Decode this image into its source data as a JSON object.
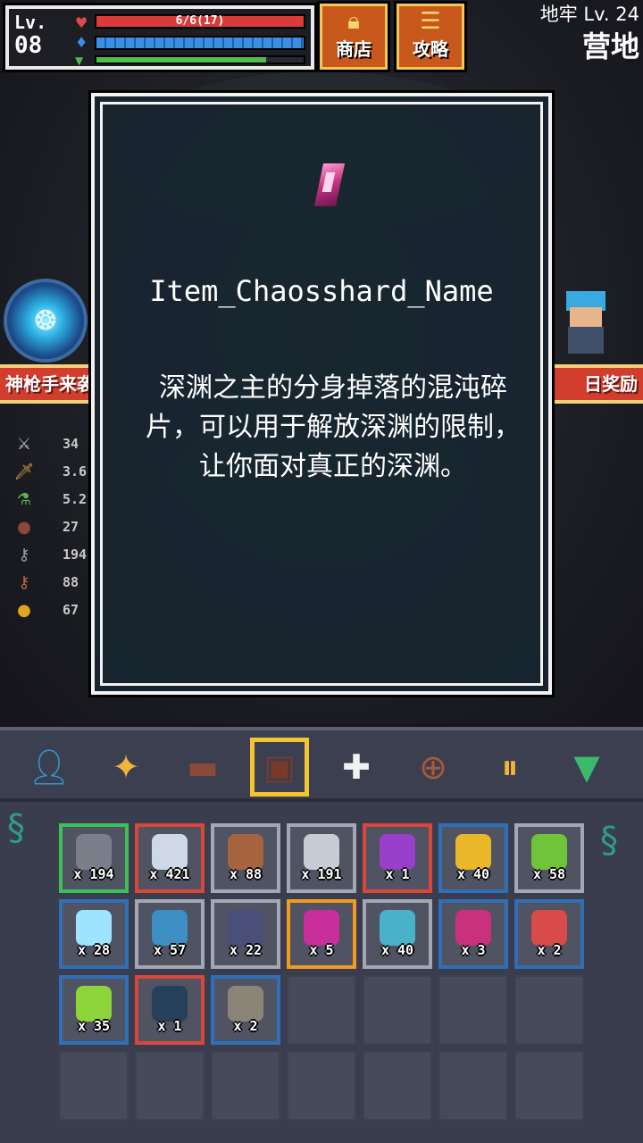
{
  "hud": {
    "level_label": "Lv.",
    "level_value": "08",
    "hp_text": "6/6(17)",
    "hp_fraction": 1.0,
    "mp_fraction": 1.0,
    "xp_fraction": 0.82,
    "colors": {
      "hp": "#d93b3b",
      "mp": "#3b8fe2",
      "xp": "#4ebc4e"
    }
  },
  "top_buttons": {
    "shop_label": "商店",
    "shop_icon": "shopping-bag-icon",
    "guide_label": "攻略",
    "guide_icon": "scroll-icon"
  },
  "location": {
    "dungeon_level": "地牢 Lv. 24",
    "area": "营地"
  },
  "side": {
    "left_banner": "神枪手来袭",
    "right_banner": "日奖励"
  },
  "stats": [
    {
      "icon": "crossed-swords-icon",
      "value": "34"
    },
    {
      "icon": "sword-icon",
      "value": "3.6"
    },
    {
      "icon": "potion-icon",
      "value": "5.2"
    },
    {
      "icon": "shield-icon",
      "value": "27"
    },
    {
      "icon": "gray-key-icon",
      "value": "194"
    },
    {
      "icon": "bronze-key-icon",
      "value": "88"
    },
    {
      "icon": "gold-coin-icon",
      "value": "67"
    }
  ],
  "tooltip": {
    "item_icon": "chaos-shard-icon",
    "item_name": "Item_Chaosshard_Name",
    "description": "深渊之主的分身掉落的混沌碎片，可以用于解放深渊的限制，让你面对真正的深渊。"
  },
  "toolbar": {
    "tabs": [
      {
        "icon": "character-silhouette-icon",
        "selected": false
      },
      {
        "icon": "sparkle-star-icon",
        "selected": false
      },
      {
        "icon": "book-icon",
        "selected": false
      },
      {
        "icon": "backpack-icon",
        "selected": true
      },
      {
        "icon": "white-cross-icon",
        "selected": false
      },
      {
        "icon": "magnifier-icon",
        "selected": false
      },
      {
        "icon": "pause-icon",
        "selected": false
      },
      {
        "icon": "collapse-arrow-icon",
        "selected": false
      }
    ]
  },
  "inventory": {
    "items": [
      {
        "icon": "gray-key-icon",
        "qty": "x 194",
        "rarity": "green"
      },
      {
        "icon": "torn-scroll-icon",
        "qty": "x 421",
        "rarity": "red"
      },
      {
        "icon": "bronze-key-icon",
        "qty": "x 88",
        "rarity": "gray"
      },
      {
        "icon": "silver-ore-icon",
        "qty": "x 191",
        "rarity": "gray"
      },
      {
        "icon": "purple-mushroom-icon",
        "qty": "x 1",
        "rarity": "red"
      },
      {
        "icon": "gold-key-icon",
        "qty": "x 40",
        "rarity": "blue"
      },
      {
        "icon": "green-tree-icon",
        "qty": "x 58",
        "rarity": "gray"
      },
      {
        "icon": "ice-crystal-icon",
        "qty": "x 28",
        "rarity": "blue"
      },
      {
        "icon": "blue-ore-icon",
        "qty": "x 57",
        "rarity": "gray"
      },
      {
        "icon": "dark-ore-icon",
        "qty": "x 22",
        "rarity": "gray"
      },
      {
        "icon": "diamond-gem-icon",
        "qty": "x 5",
        "rarity": "orange"
      },
      {
        "icon": "aqua-ore-icon",
        "qty": "x 40",
        "rarity": "gray"
      },
      {
        "icon": "chaos-shard-icon",
        "qty": "x 3",
        "rarity": "blue"
      },
      {
        "icon": "red-mushroom-icon",
        "qty": "x 2",
        "rarity": "blue"
      },
      {
        "icon": "green-gem-icon",
        "qty": "x 35",
        "rarity": "blue"
      },
      {
        "icon": "dark-crystal-icon",
        "qty": "x 1",
        "rarity": "red"
      },
      {
        "icon": "stone-disc-icon",
        "qty": "x 2",
        "rarity": "blue"
      }
    ],
    "rarity_colors": {
      "green": "#3fbf5a",
      "red": "#d9473a",
      "gray": "#a3a6b3",
      "blue": "#2f6fb8",
      "orange": "#f39a1c"
    }
  }
}
